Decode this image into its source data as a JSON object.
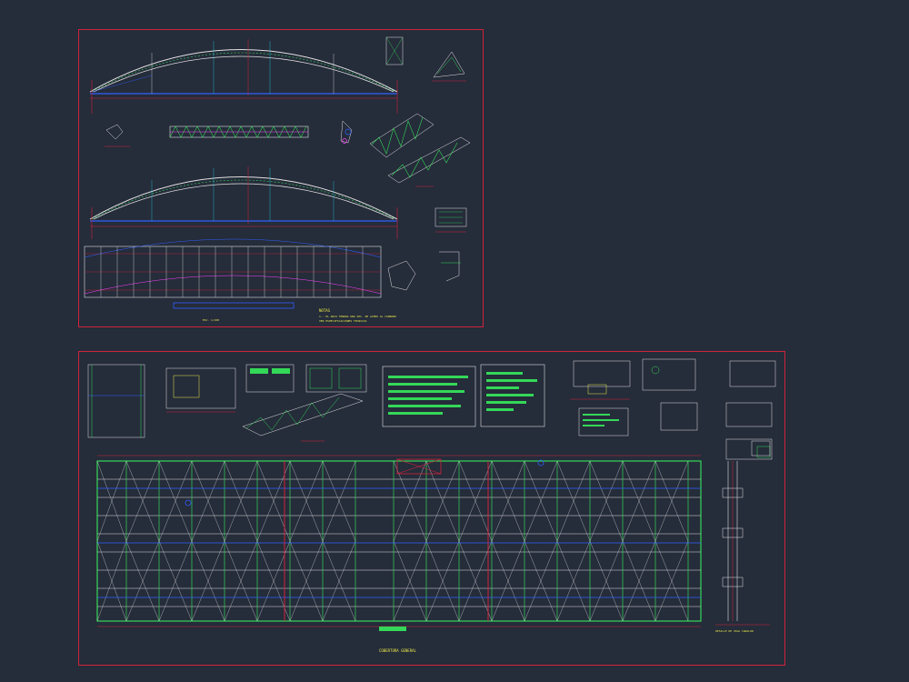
{
  "drawing": {
    "background": "#252c3a",
    "frame_color": "#d0233c",
    "line_colors": {
      "structure": "#e0e0e0",
      "truss": "#34d858",
      "beam": "#3060ff",
      "annotation": "#e8e84a",
      "cyan": "#20d0e0",
      "magenta": "#ff40ff",
      "red": "#ff2020"
    }
  },
  "top_sheet": {
    "notes_title": "NOTAS",
    "notes_text": "1.- EL ARCO TENDRA UNA SEC. DE ACERO AL CARBONO",
    "notes_sub": "VER ESPECIFICACIONES TECNICAS",
    "scale": "ESC. 1/100"
  },
  "bottom_sheet": {
    "plan_title": "COBERTURA GENERAL",
    "detail_title": "DETALLE DE VIGA CANALON"
  }
}
